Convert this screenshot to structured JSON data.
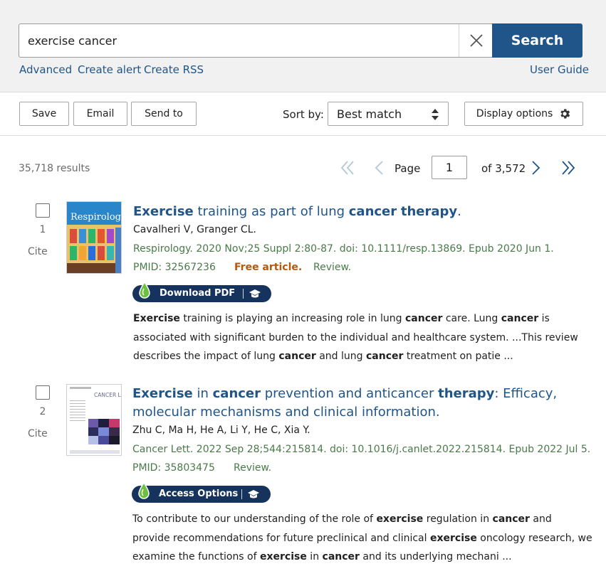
{
  "search": {
    "value": "exercise cancer",
    "button_label": "Search"
  },
  "links": {
    "advanced": "Advanced",
    "create_alert": "Create alert",
    "create_rss": "Create RSS",
    "user_guide": "User Guide"
  },
  "toolbar": {
    "save": "Save",
    "email": "Email",
    "send_to": "Send to",
    "sort_by_label": "Sort by:",
    "sort_value": "Best match",
    "display_options": "Display options"
  },
  "pagination": {
    "results_count": "35,718 results",
    "page_label": "Page",
    "current_page": "1",
    "of_total": "of 3,572"
  },
  "colors": {
    "accent": "#20558a",
    "journal_green": "#4a7a4a",
    "free_article": "#b5580b",
    "pill_bg": "#15335c",
    "drop_green": "#6dbf3f"
  },
  "results": [
    {
      "number": "1",
      "cite": "Cite",
      "thumb_title": "Respirology",
      "title_parts": [
        "Exercise",
        " training as part of lung ",
        "cancer",
        " ",
        "therapy",
        "."
      ],
      "authors": "Cavalheri V, Granger CL.",
      "citation": "Respirology. 2020 Nov;25 Suppl 2:80-87. doi: 10.1111/resp.13869. Epub 2020 Jun 1.",
      "pmid": "PMID: 32567236",
      "free_article": "Free article.",
      "type": "Review.",
      "pill_label": "Download PDF",
      "snippet_lines": [
        [
          "Exercise",
          " training is playing an increasing role in lung ",
          "cancer",
          " care. Lung ",
          "cancer",
          " is"
        ],
        [
          "associated with significant burden to the individual and healthcare system. ...This review"
        ],
        [
          "describes the impact of lung ",
          "cancer",
          " and lung ",
          "cancer",
          " treatment on patie ..."
        ]
      ]
    },
    {
      "number": "2",
      "cite": "Cite",
      "thumb_title": "CANCER LETTERS",
      "title_line1_parts": [
        "Exercise",
        " in ",
        "cancer",
        " prevention and anticancer ",
        "therapy",
        ": Efficacy,"
      ],
      "title_line2": "molecular mechanisms and clinical information.",
      "authors": "Zhu C, Ma H, He A, Li Y, He C, Xia Y.",
      "citation": "Cancer Lett. 2022 Sep 28;544:215814. doi: 10.1016/j.canlet.2022.215814. Epub 2022 Jul 5.",
      "pmid": "PMID: 35803475",
      "type": "Review.",
      "pill_label": "Access Options",
      "snippet_lines": [
        [
          "To contribute to our understanding of the role of ",
          "exercise",
          " regulation in ",
          "cancer",
          " and"
        ],
        [
          "provide recommendations for future preclinical and clinical ",
          "exercise",
          " oncology research, we"
        ],
        [
          "examine the functions of ",
          "exercise",
          " in ",
          "cancer",
          " and its underlying mechani ..."
        ]
      ]
    }
  ],
  "icons": {
    "clear": "close-icon",
    "sort": "sort-arrows-icon",
    "display": "gear-icon",
    "first": "double-chevron-left-icon",
    "prev": "chevron-left-icon",
    "next": "chevron-right-icon",
    "last": "double-chevron-right-icon",
    "pill_left": "droplet-icon",
    "pill_right": "graduation-cap-icon"
  }
}
